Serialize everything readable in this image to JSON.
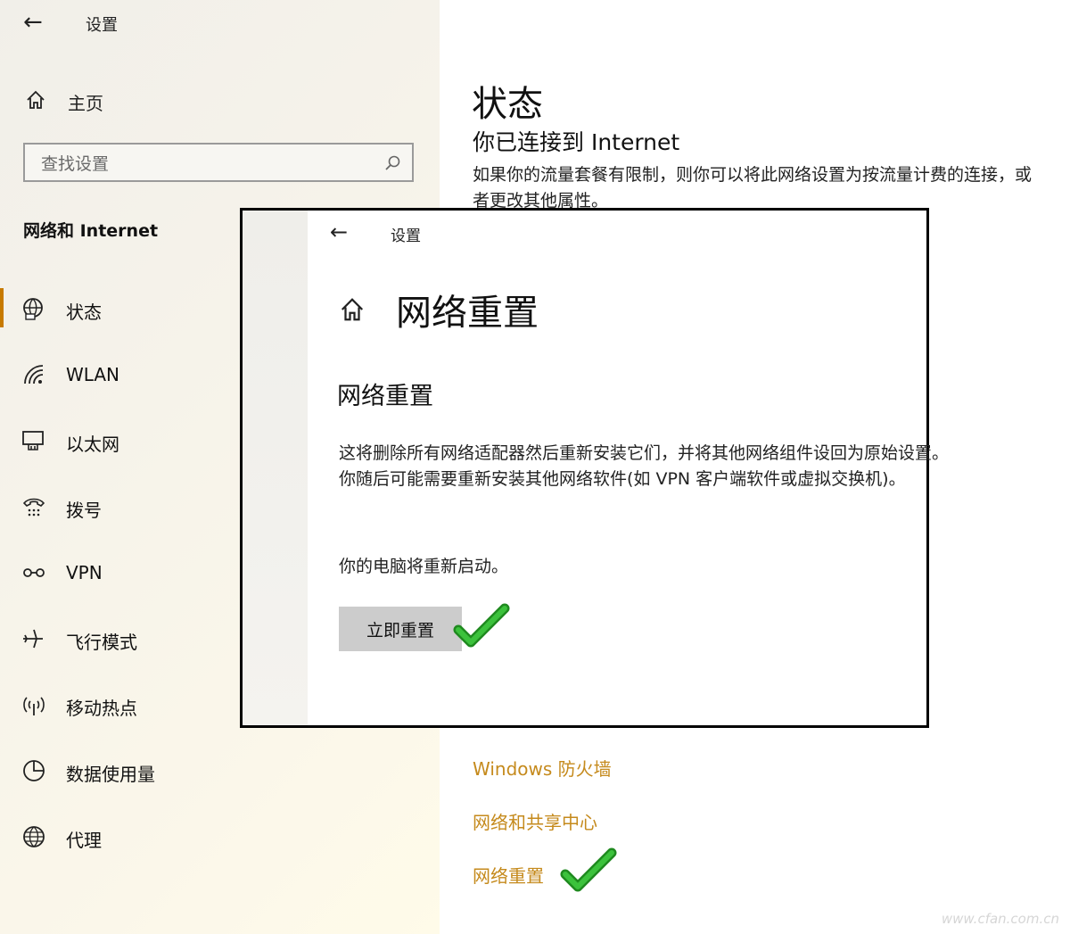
{
  "sidebar": {
    "title": "设置",
    "home_label": "主页",
    "search_placeholder": "查找设置",
    "section_title": "网络和 Internet",
    "items": [
      {
        "label": "状态"
      },
      {
        "label": "WLAN"
      },
      {
        "label": "以太网"
      },
      {
        "label": "拨号"
      },
      {
        "label": "VPN"
      },
      {
        "label": "飞行模式"
      },
      {
        "label": "移动热点"
      },
      {
        "label": "数据使用量"
      },
      {
        "label": "代理"
      }
    ]
  },
  "main": {
    "title": "状态",
    "subtitle": "你已连接到 Internet",
    "description": "如果你的流量套餐有限制，则你可以将此网络设置为按流量计费的连接，或者更改其他属性。",
    "links": [
      "Windows 防火墙",
      "网络和共享中心",
      "网络重置"
    ]
  },
  "overlay": {
    "settings_label": "设置",
    "title": "网络重置",
    "heading": "网络重置",
    "description": "这将删除所有网络适配器然后重新安装它们，并将其他网络组件设回为原始设置。你随后可能需要重新安装其他网络软件(如 VPN 客户端软件或虚拟交换机)。",
    "restart_note": "你的电脑将重新启动。",
    "reset_button": "立即重置"
  },
  "watermark": "www.cfan.com.cn",
  "colors": {
    "accent": "#c77a00",
    "link": "#c58a1c",
    "check": "#2aa52a"
  }
}
